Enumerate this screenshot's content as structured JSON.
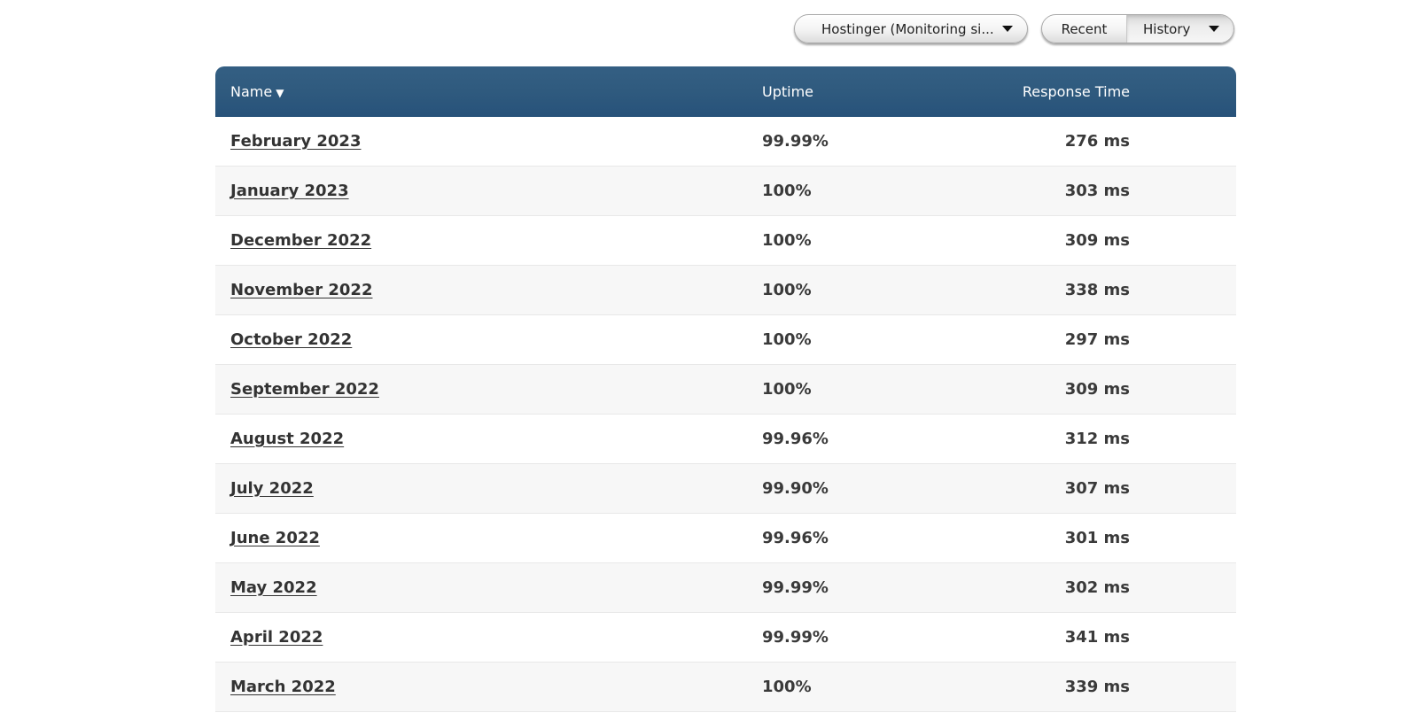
{
  "toolbar": {
    "site_select": {
      "label": "Hostinger (Monitoring si...",
      "icon": "caret-down-icon"
    },
    "view_toggle": {
      "options": [
        {
          "label": "Recent",
          "active": false
        },
        {
          "label": "History",
          "active": true,
          "icon": "caret-down-icon"
        }
      ]
    }
  },
  "table": {
    "header_color": "#2f5a7e",
    "columns": [
      {
        "label": "Name",
        "sort_indicator": "▼"
      },
      {
        "label": "Uptime"
      },
      {
        "label": "Response Time"
      }
    ],
    "rows": [
      {
        "name": "February 2023",
        "uptime": "99.99%",
        "response": "276 ms"
      },
      {
        "name": "January 2023",
        "uptime": "100%",
        "response": "303 ms"
      },
      {
        "name": "December 2022",
        "uptime": "100%",
        "response": "309 ms"
      },
      {
        "name": "November 2022",
        "uptime": "100%",
        "response": "338 ms"
      },
      {
        "name": "October 2022",
        "uptime": "100%",
        "response": "297 ms"
      },
      {
        "name": "September 2022",
        "uptime": "100%",
        "response": "309 ms"
      },
      {
        "name": "August 2022",
        "uptime": "99.96%",
        "response": "312 ms"
      },
      {
        "name": "July 2022",
        "uptime": "99.90%",
        "response": "307 ms"
      },
      {
        "name": "June 2022",
        "uptime": "99.96%",
        "response": "301 ms"
      },
      {
        "name": "May 2022",
        "uptime": "99.99%",
        "response": "302 ms"
      },
      {
        "name": "April 2022",
        "uptime": "99.99%",
        "response": "341 ms"
      },
      {
        "name": "March 2022",
        "uptime": "100%",
        "response": "339 ms"
      }
    ]
  }
}
